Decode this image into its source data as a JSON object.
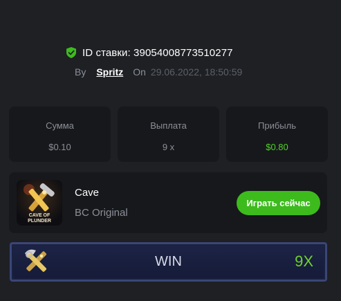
{
  "bet": {
    "id_label": "ID ставки: 39054008773510277",
    "by_label": "By",
    "username": "Spritz",
    "on_label": "On",
    "datetime": "29.06.2022, 18:50:59"
  },
  "stats": [
    {
      "label": "Сумма",
      "value": "$0.10"
    },
    {
      "label": "Выплата",
      "value": "9 x"
    },
    {
      "label": "Прибыль",
      "value": "$0.80"
    }
  ],
  "game": {
    "name": "Cave",
    "provider": "BC Original",
    "thumb_caption_1": "CAVE OF",
    "thumb_caption_2": "PLUNDER",
    "play_label": "Играть сейчас"
  },
  "result": {
    "label": "WIN",
    "multiplier": "9X"
  },
  "colors": {
    "accent_green": "#3dbb1d",
    "profit_green": "#4fd327",
    "background": "#1e2024",
    "card": "#17181b"
  },
  "icons": [
    "verified-shield-icon",
    "pickaxe-icon"
  ]
}
